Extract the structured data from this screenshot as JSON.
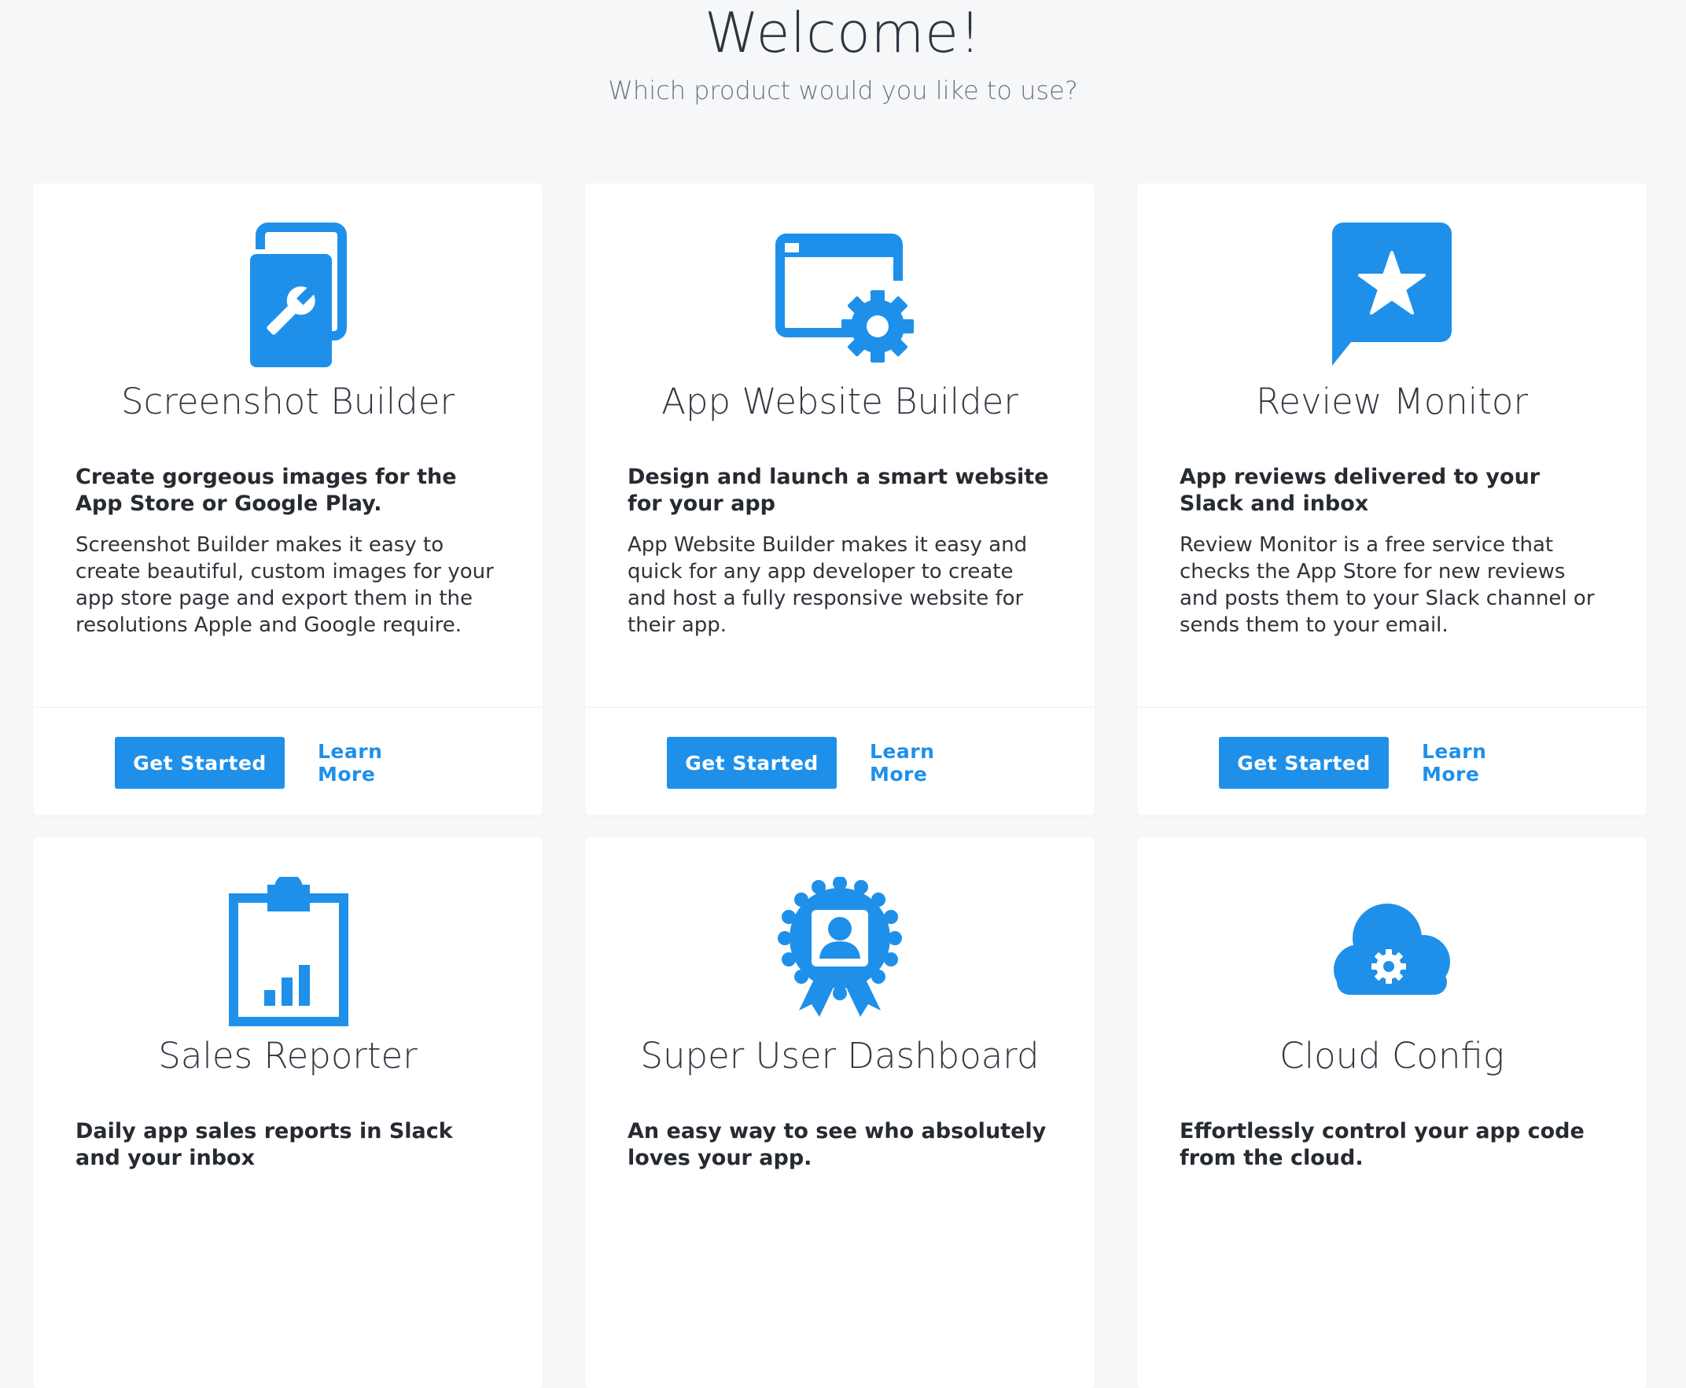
{
  "header": {
    "title": "Welcome!",
    "subtitle": "Which product would you like to use?"
  },
  "accent_color": "#1e90ea",
  "products": [
    {
      "icon": "screenshot-builder-icon",
      "title": "Screenshot Builder",
      "tagline": "Create gorgeous images for the App Store or Google Play.",
      "description": "Screenshot Builder makes it easy to create beautiful, custom images for your app store page and export them in the resolutions Apple and Google require.",
      "primary_label": "Get Started",
      "secondary_label": "Learn More"
    },
    {
      "icon": "app-website-builder-icon",
      "title": "App Website Builder",
      "tagline": "Design and launch a smart website for your app",
      "description": "App Website Builder makes it easy and quick for any app developer to create and host a fully responsive website for their app.",
      "primary_label": "Get Started",
      "secondary_label": "Learn More"
    },
    {
      "icon": "review-monitor-icon",
      "title": "Review Monitor",
      "tagline": "App reviews delivered to your Slack and inbox",
      "description": "Review Monitor is a free service that checks the App Store for new reviews and posts them to your Slack channel or sends them to your email.",
      "primary_label": "Get Started",
      "secondary_label": "Learn More"
    },
    {
      "icon": "sales-reporter-icon",
      "title": "Sales Reporter",
      "tagline": "Daily app sales reports in Slack and your inbox"
    },
    {
      "icon": "super-user-dashboard-icon",
      "title": "Super User Dashboard",
      "tagline": "An easy way to see who absolutely loves your app."
    },
    {
      "icon": "cloud-config-icon",
      "title": "Cloud Config",
      "tagline": "Effortlessly control your app code from the cloud."
    }
  ]
}
